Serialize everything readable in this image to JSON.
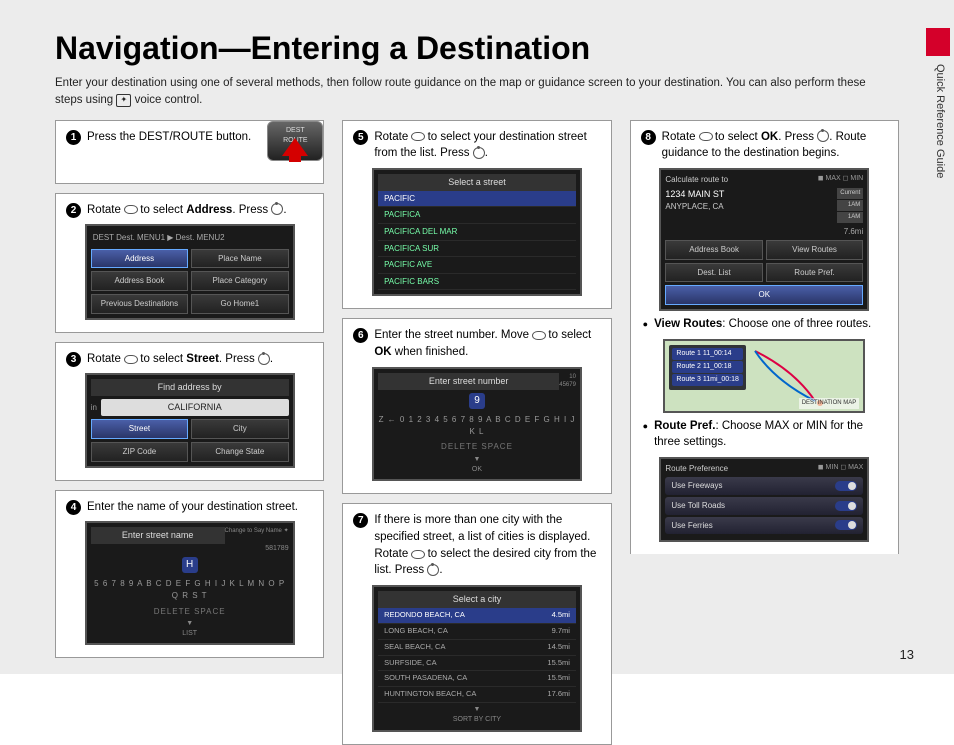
{
  "page_title": "Navigation—Entering a Destination",
  "side_label": "Quick Reference Guide",
  "page_number": "13",
  "intro_a": "Enter your destination using one of several methods, then follow route guidance on the map or guidance screen to your destination. You can also perform these steps using ",
  "intro_b": " voice control.",
  "voice_glyph": "✦",
  "steps": {
    "s1": {
      "num": "1",
      "text_a": "Press the DEST/ROUTE button.",
      "btn_label": "DEST\nROUTE"
    },
    "s2": {
      "num": "2",
      "text_a": "Rotate ",
      "text_b": " to select ",
      "bold": "Address",
      "text_c": ". Press ",
      "text_d": ".",
      "screen": {
        "header": "DEST     Dest. MENU1 ▶ Dest. MENU2",
        "items": [
          "Address",
          "Place Name",
          "Address Book",
          "Place Category",
          "Previous Destinations",
          "Go Home1"
        ],
        "selected": 0
      }
    },
    "s3": {
      "num": "3",
      "text_a": "Rotate ",
      "text_b": " to select ",
      "bold": "Street",
      "text_c": ". Press ",
      "text_d": ".",
      "screen": {
        "title": "Find address by",
        "state_label": "in",
        "state": "CALIFORNIA",
        "items": [
          "Street",
          "City",
          "ZIP Code",
          "Change State"
        ],
        "selected": 0
      }
    },
    "s4": {
      "num": "4",
      "text": "Enter the name of your destination street.",
      "screen": {
        "title": "Enter street name",
        "corner": "Change to Say Name ✦",
        "counter": "581789",
        "letter": "H",
        "row": "5 6 7 8 9  A B C D E F G H I J K L M N O P Q R S T",
        "actions": "DELETE     SPACE",
        "footer": "LIST"
      }
    },
    "s5": {
      "num": "5",
      "text_a": "Rotate ",
      "text_b": " to select your destination street from the list. Press ",
      "text_c": ".",
      "screen": {
        "title": "Select a street",
        "items": [
          "PACIFIC",
          "PACIFICA",
          "PACIFICA DEL MAR",
          "PACIFICA SUR",
          "PACIFIC AVE",
          "PACIFIC BARS"
        ],
        "selected": 0
      }
    },
    "s6": {
      "num": "6",
      "text_a": "Enter the street number. Move ",
      "text_b": " to select ",
      "bold": "OK",
      "text_c": " when finished.",
      "screen": {
        "title": "Enter street number",
        "corner": "10\n45679",
        "digit": "9",
        "row": "Z ← 0 1 2 3 4 5 6 7 8 9  A B C D E F G H I J K L",
        "actions": "DELETE     SPACE",
        "footer": "OK"
      }
    },
    "s7": {
      "num": "7",
      "text_a": "If there is more than one city with the specified street, a list of cities is displayed. Rotate ",
      "text_b": " to select the desired city from the list. Press ",
      "text_c": ".",
      "screen": {
        "title": "Select a city",
        "items": [
          {
            "name": "REDONDO BEACH, CA",
            "dist": "4.5mi"
          },
          {
            "name": "LONG BEACH, CA",
            "dist": "9.7mi"
          },
          {
            "name": "SEAL BEACH, CA",
            "dist": "14.5mi"
          },
          {
            "name": "SURFSIDE, CA",
            "dist": "15.5mi"
          },
          {
            "name": "SOUTH PASADENA, CA",
            "dist": "15.5mi"
          },
          {
            "name": "HUNTINGTON BEACH, CA",
            "dist": "17.6mi"
          }
        ],
        "footer": "SORT BY CITY",
        "selected": 0
      }
    },
    "s8": {
      "num": "8",
      "text_a": "Rotate ",
      "text_b": " to select ",
      "bold": "OK",
      "text_c": ". Press ",
      "text_d": ". Route guidance to the destination begins.",
      "screen": {
        "title": "Calculate route to",
        "badge": "◼ MAX ◻ MIN",
        "addr1": "1234 MAIN ST",
        "addr2": "ANYPLACE, CA",
        "side": [
          "Current",
          "1AM",
          "1AM"
        ],
        "dist": "7.6mi",
        "items": [
          "Address Book",
          "View Routes",
          "Dest. List",
          "Route Pref.",
          "OK"
        ],
        "selected": 4
      }
    }
  },
  "bullets": {
    "view_routes": {
      "bold": "View Routes",
      "text": ": Choose one of three routes."
    },
    "route_pref": {
      "bold": "Route Pref.",
      "text": ": Choose MAX or MIN for the three settings."
    }
  },
  "map_screen": {
    "routes": [
      "Route 1  11_00:14",
      "Route 2  11_00:18",
      "Route 3  11mi_00:18"
    ],
    "footer": "DESTINATION MAP"
  },
  "pref_screen": {
    "title": "Route Preference",
    "badge": "◼ MIN ◻ MAX",
    "items": [
      "Use Freeways",
      "Use Toll Roads",
      "Use Ferries"
    ]
  }
}
